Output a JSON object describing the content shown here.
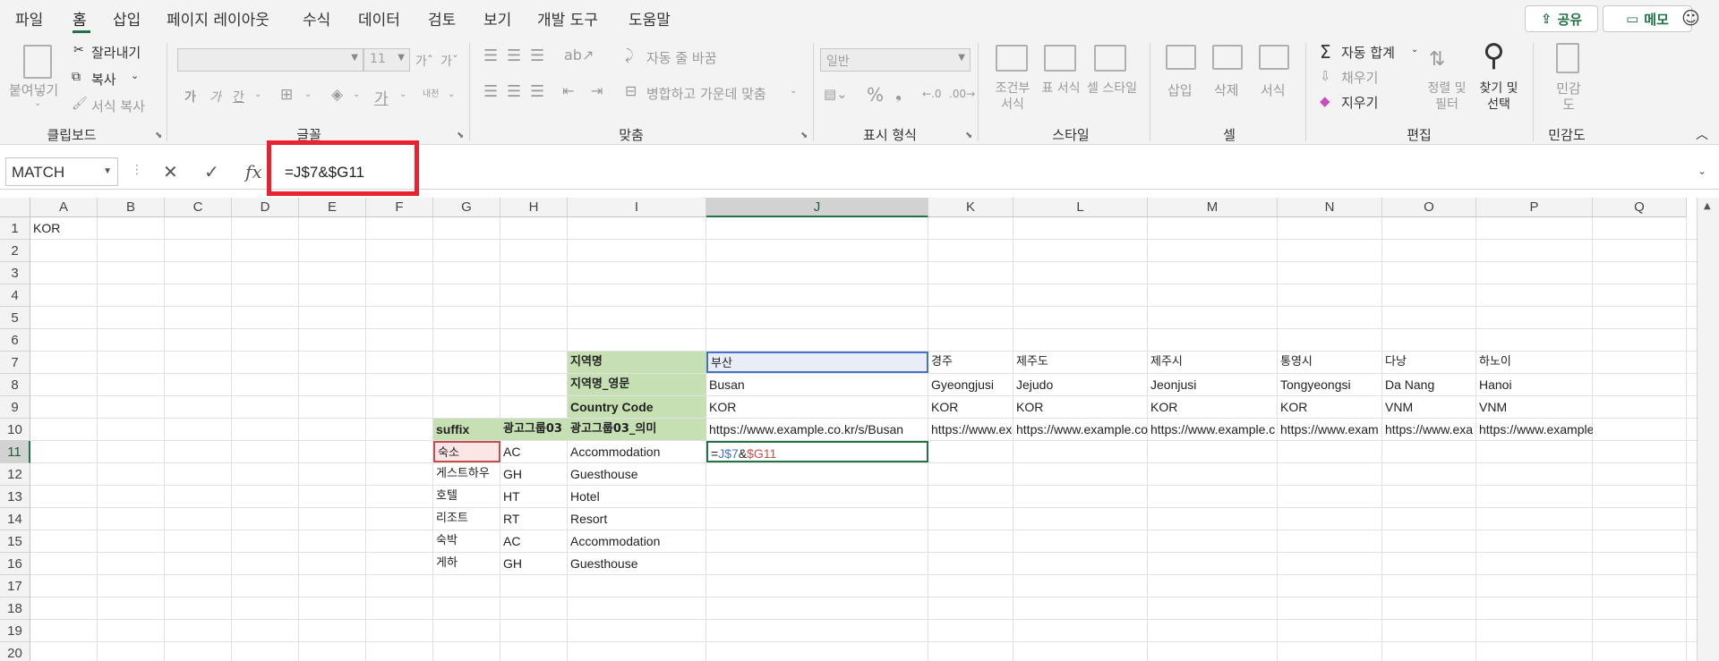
{
  "menu": {
    "tabs": [
      "파일",
      "홈",
      "삽입",
      "페이지 레이아웃",
      "수식",
      "데이터",
      "검토",
      "보기",
      "개발 도구",
      "도움말"
    ],
    "share_label": "공유",
    "comment_label": "메모"
  },
  "ribbon": {
    "clipboard": {
      "paste": "붙여넣기",
      "cut": "잘라내기",
      "copy": "복사",
      "format_painter": "서식 복사",
      "group": "클립보드"
    },
    "font": {
      "name_value": "",
      "size_value": "11",
      "group": "글꼴"
    },
    "align": {
      "wrap": "자동 줄 바꿈",
      "merge": "병합하고 가운데 맞춤",
      "group": "맞춤"
    },
    "number": {
      "format_value": "일반",
      "group": "표시 형식"
    },
    "styles": {
      "cond": "조건부 서식",
      "table": "표 서식",
      "cell": "셀 스타일",
      "group": "스타일"
    },
    "cells": {
      "insert": "삽입",
      "delete": "삭제",
      "format": "서식",
      "group": "셀"
    },
    "editing": {
      "autosum": "자동 합계",
      "fill": "채우기",
      "clear": "지우기",
      "sort": "정렬 및 필터",
      "find": "찾기 및 선택",
      "group": "편집"
    },
    "sensitivity": {
      "label": "민감도",
      "group": "민감도"
    }
  },
  "formula_bar": {
    "name_box": "MATCH",
    "formula": "=J$7&$G11"
  },
  "grid": {
    "columns": [
      "A",
      "B",
      "C",
      "D",
      "E",
      "F",
      "G",
      "H",
      "I",
      "J",
      "K",
      "L",
      "M",
      "N",
      "O",
      "P",
      "Q"
    ],
    "rows": [
      "1",
      "2",
      "3",
      "4",
      "5",
      "6",
      "7",
      "8",
      "9",
      "10",
      "11",
      "12",
      "13",
      "14",
      "15",
      "16",
      "17",
      "18",
      "19",
      "20"
    ],
    "cells": {
      "A1": "KOR",
      "I7": "지역명",
      "J7": "부산",
      "K7": "경주",
      "L7": "제주도",
      "M7": "제주시",
      "N7": "통영시",
      "O7": "다낭",
      "P7": "하노이",
      "I8": "지역명_영문",
      "J8": "Busan",
      "K8": "Gyeongjusi",
      "L8": "Jejudo",
      "M8": "Jeonjusi",
      "N8": "Tongyeongsi",
      "O8": "Da Nang",
      "P8": "Hanoi",
      "I9": "Country Code",
      "J9": "KOR",
      "K9": "KOR",
      "L9": "KOR",
      "M9": "KOR",
      "N9": "KOR",
      "O9": "VNM",
      "P9": "VNM",
      "G10": "suffix",
      "H10": "광고그룹03",
      "I10": "광고그룹03_의미",
      "J10": "https://www.example.co.kr/s/Busan",
      "K10": "https://www.ex",
      "L10": "https://www.example.co",
      "M10": "https://www.example.c",
      "N10": "https://www.exam",
      "O10": "https://www.exa",
      "P10": "https://www.example.co.kr/s/Hanoi",
      "G11": "숙소",
      "H11": "AC",
      "I11": "Accommodation",
      "J11_a": "=",
      "J11_b": "J$7",
      "J11_c": "&",
      "J11_d": "$G11",
      "G12": "게스트하우",
      "H12": "GH",
      "I12": "Guesthouse",
      "G13": "호텔",
      "H13": "HT",
      "I13": "Hotel",
      "G14": "리조트",
      "H14": "RT",
      "I14": "Resort",
      "G15": "숙박",
      "H15": "AC",
      "I15": "Accommodation",
      "G16": "게하",
      "H16": "GH",
      "I16": "Guesthouse"
    }
  }
}
